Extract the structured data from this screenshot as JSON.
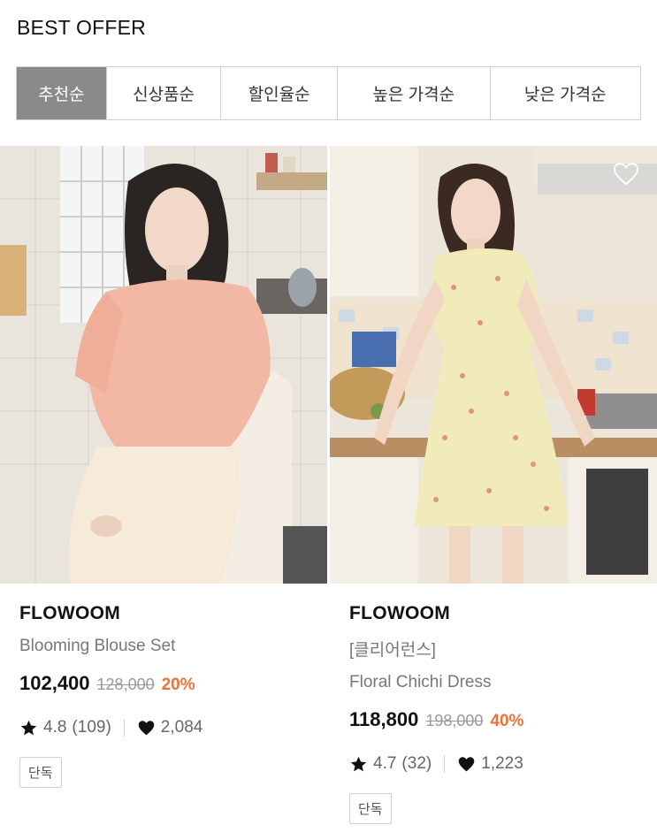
{
  "section": {
    "title": "BEST OFFER"
  },
  "tabs": [
    "추천순",
    "신상품순",
    "할인율순",
    "높은 가격순",
    "낮은 가격순"
  ],
  "active_tab": 0,
  "products": [
    {
      "brand": "FLOWOOM",
      "subtitle": "",
      "name": "Blooming Blouse Set",
      "price": "102,400",
      "original_price": "128,000",
      "discount": "20%",
      "rating": "4.8",
      "reviews": "(109)",
      "likes": "2,084",
      "tag": "단독"
    },
    {
      "brand": "FLOWOOM",
      "subtitle": "[클리어런스]",
      "name": "Floral Chichi Dress",
      "price": "118,800",
      "original_price": "198,000",
      "discount": "40%",
      "rating": "4.7",
      "reviews": "(32)",
      "likes": "1,223",
      "tag": "단독"
    }
  ],
  "colors": {
    "accent": "#e7743b",
    "active_tab_bg": "#8a8a8a"
  },
  "icons": {
    "rating": "star-icon",
    "likes": "heart-icon",
    "wishlist": "heart-outline-icon"
  }
}
